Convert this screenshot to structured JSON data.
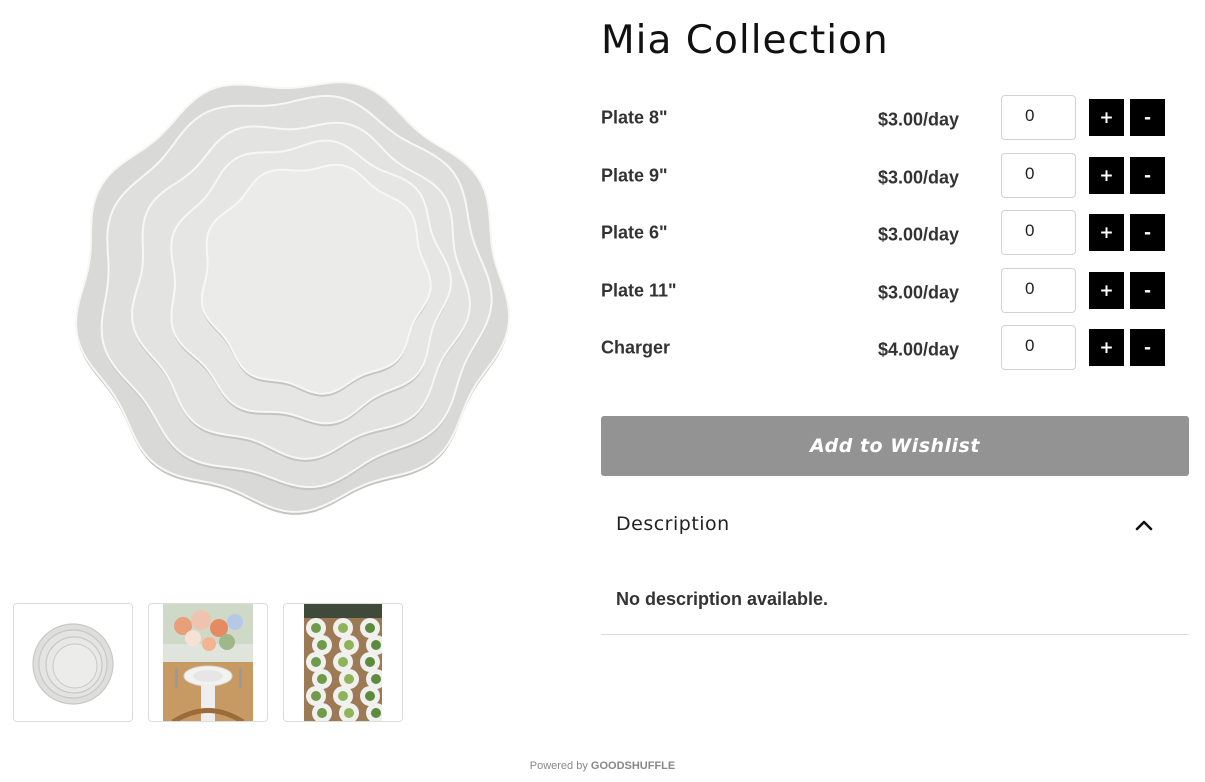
{
  "product": {
    "title": "Mia Collection",
    "main_image": "stacked-white-scalloped-plates",
    "thumbnails": [
      {
        "name": "stacked-plates-thumbnail"
      },
      {
        "name": "floral-table-setting-thumbnail"
      },
      {
        "name": "plated-banquet-table-thumbnail"
      }
    ]
  },
  "items": [
    {
      "name": "Plate 8\"",
      "price": "$3.00/day",
      "quantity": "0"
    },
    {
      "name": "Plate 9\"",
      "price": "$3.00/day",
      "quantity": "0"
    },
    {
      "name": "Plate 6\"",
      "price": "$3.00/day",
      "quantity": "0"
    },
    {
      "name": "Plate 11\"",
      "price": "$3.00/day",
      "quantity": "0"
    },
    {
      "name": "Charger",
      "price": "$4.00/day",
      "quantity": "0"
    }
  ],
  "buttons": {
    "plus_label": "+",
    "minus_label": "-",
    "wishlist_label": "Add to Wishlist"
  },
  "description": {
    "title": "Description",
    "body": "No description available.",
    "icon": "chevron-up-icon"
  },
  "footer": {
    "powered_prefix": "Powered by",
    "brand": "GOODSHUFFLE"
  },
  "colors": {
    "button_black": "#000000",
    "wishlist_gray": "#939393"
  }
}
